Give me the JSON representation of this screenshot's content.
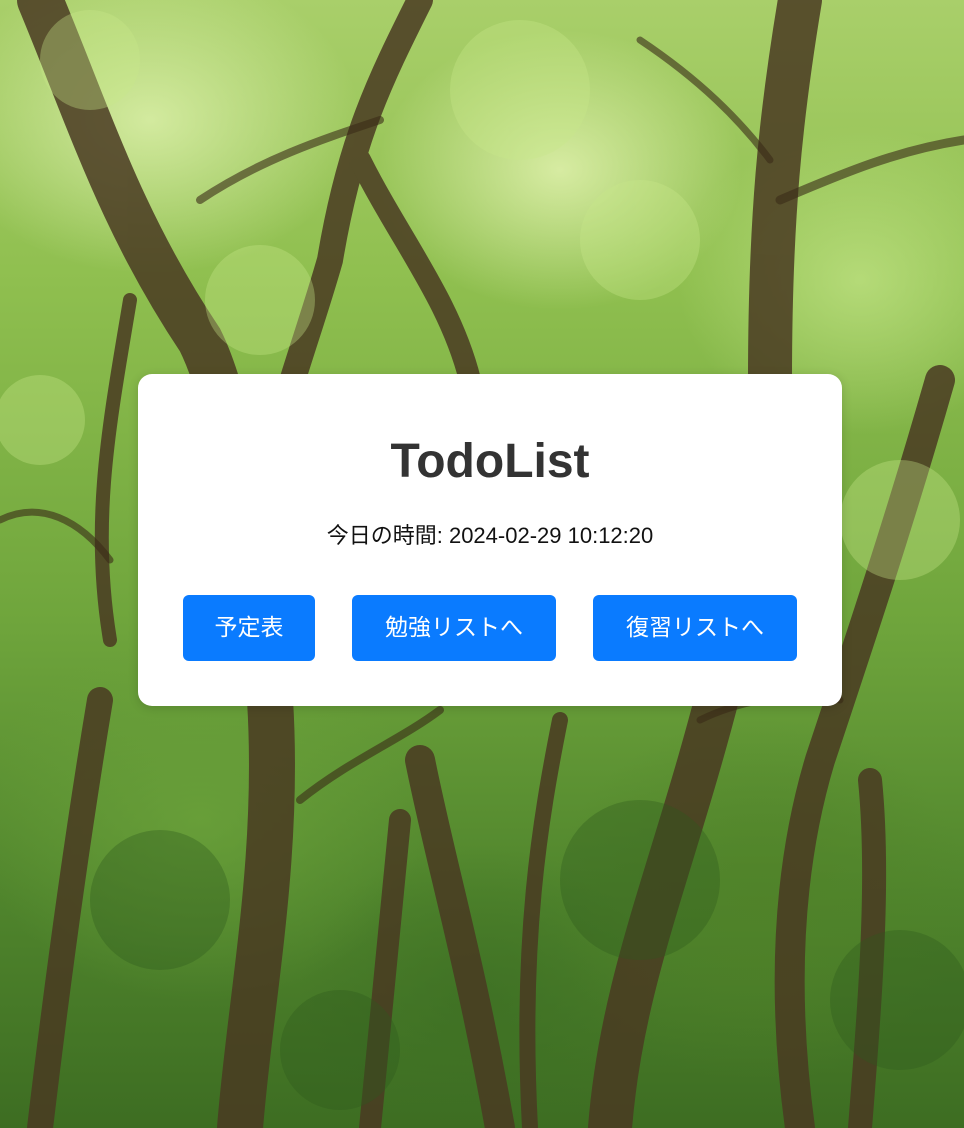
{
  "app": {
    "title": "TodoList"
  },
  "clock": {
    "label": "今日の時間: 2024-02-29 10:12:20"
  },
  "buttons": {
    "schedule": "予定表",
    "study_list": "勉強リストへ",
    "review_list": "復習リストへ"
  },
  "colors": {
    "button": "#0a7bff",
    "title": "#333333",
    "card": "#ffffff"
  },
  "background": {
    "icon": "forest-background-image"
  }
}
